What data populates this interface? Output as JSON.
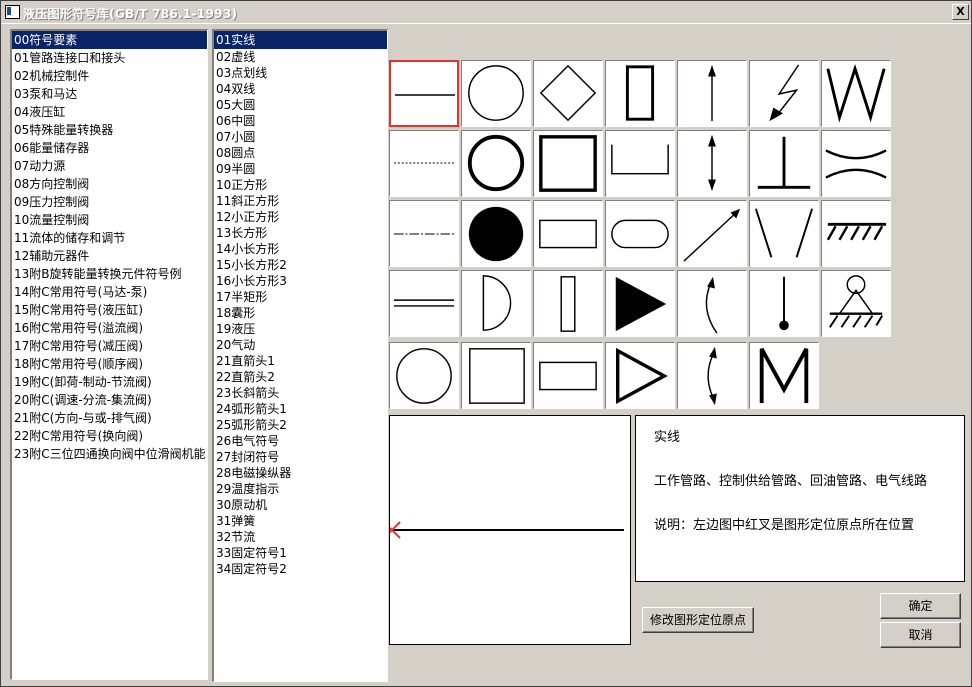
{
  "window": {
    "title": "液压图形符号库(GB/T 786.1-1993)",
    "close_glyph": "X"
  },
  "categories": [
    {
      "label": "00符号要素"
    },
    {
      "label": "01管路连接口和接头"
    },
    {
      "label": "02机械控制件"
    },
    {
      "label": "03泵和马达"
    },
    {
      "label": "04液压缸"
    },
    {
      "label": "05特殊能量转换器"
    },
    {
      "label": "06能量储存器"
    },
    {
      "label": "07动力源"
    },
    {
      "label": "08方向控制阀"
    },
    {
      "label": "09压力控制阀"
    },
    {
      "label": "10流量控制阀"
    },
    {
      "label": "11流体的储存和调节"
    },
    {
      "label": "12辅助元器件"
    },
    {
      "label": "13附B旋转能量转换元件符号例"
    },
    {
      "label": "14附C常用符号(马达-泵)"
    },
    {
      "label": "15附C常用符号(液压缸)"
    },
    {
      "label": "16附C常用符号(溢流阀)"
    },
    {
      "label": "17附C常用符号(减压阀)"
    },
    {
      "label": "18附C常用符号(顺序阀)"
    },
    {
      "label": "19附C(卸荷-制动-节流阀)"
    },
    {
      "label": "20附C(调速-分流-集流阀)"
    },
    {
      "label": "21附C(方向-与或-排气阀)"
    },
    {
      "label": "22附C常用符号(换向阀)"
    },
    {
      "label": "23附C三位四通换向阀中位滑阀机能"
    }
  ],
  "symbols": [
    {
      "label": "01实线"
    },
    {
      "label": "02虚线"
    },
    {
      "label": "03点划线"
    },
    {
      "label": "04双线"
    },
    {
      "label": "05大圆"
    },
    {
      "label": "06中圆"
    },
    {
      "label": "07小圆"
    },
    {
      "label": "08圆点"
    },
    {
      "label": "09半圆"
    },
    {
      "label": "10正方形"
    },
    {
      "label": "11斜正方形"
    },
    {
      "label": "12小正方形"
    },
    {
      "label": "13长方形"
    },
    {
      "label": "14小长方形"
    },
    {
      "label": "15小长方形2"
    },
    {
      "label": "16小长方形3"
    },
    {
      "label": "17半矩形"
    },
    {
      "label": "18囊形"
    },
    {
      "label": "19液压"
    },
    {
      "label": "20气动"
    },
    {
      "label": "21直箭头1"
    },
    {
      "label": "22直箭头2"
    },
    {
      "label": "23长斜箭头"
    },
    {
      "label": "24弧形箭头1"
    },
    {
      "label": "25弧形箭头2"
    },
    {
      "label": "26电气符号"
    },
    {
      "label": "27封闭符号"
    },
    {
      "label": "28电磁操纵器"
    },
    {
      "label": "29温度指示"
    },
    {
      "label": "30原动机"
    },
    {
      "label": "31弹簧"
    },
    {
      "label": "32节流"
    },
    {
      "label": "33固定符号1"
    },
    {
      "label": "34固定符号2"
    }
  ],
  "description": {
    "name": "实线",
    "usage": "工作管路、控制供给管路、回油管路、电气线路",
    "note": "说明：左边图中红叉是图形定位原点所在位置"
  },
  "buttons": {
    "modify_origin": "修改图形定位原点",
    "ok": "确定",
    "cancel": "取消"
  },
  "colors": {
    "selection": "#0a246a",
    "highlight": "#e53030"
  }
}
